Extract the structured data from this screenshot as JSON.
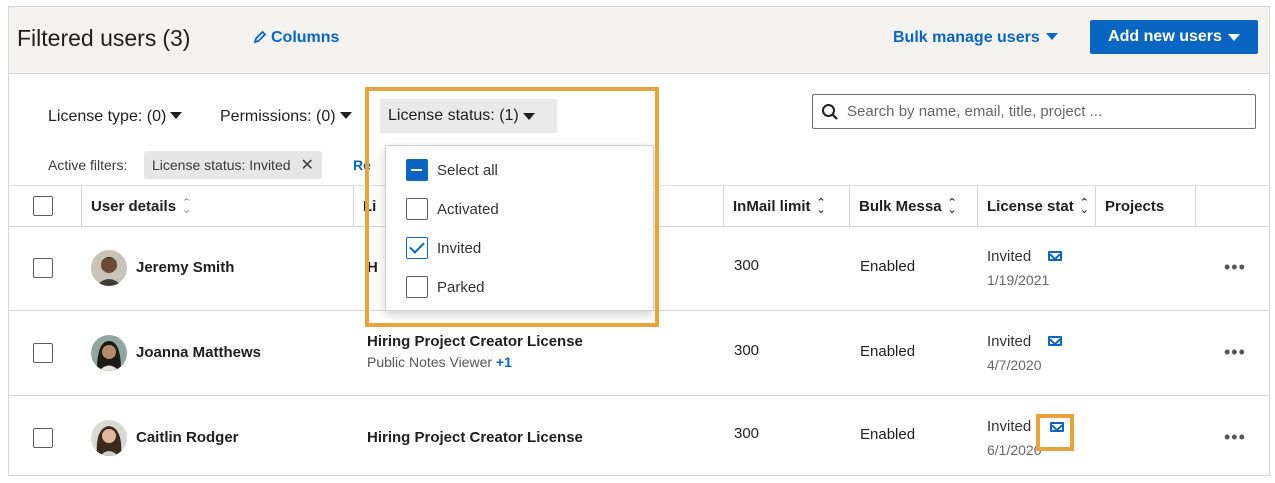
{
  "header": {
    "title": "Filtered users",
    "count": "(3)",
    "columns_label": "Columns",
    "bulk_manage_label": "Bulk manage users",
    "add_users_label": "Add new users"
  },
  "filters": {
    "license_type": "License type:",
    "license_type_count": "(0)",
    "permissions": "Permissions:",
    "permissions_count": "(0)",
    "license_status": "License status:",
    "license_status_count": "(1)",
    "search_placeholder": "Search by name, email, title, project ..."
  },
  "active_filters": {
    "label": "Active filters:",
    "chip": "License status: Invited",
    "chip_close": "✕",
    "reset_partial": "Re"
  },
  "menu": {
    "items": [
      {
        "label": "Select all",
        "state": "indeterminate"
      },
      {
        "label": "Activated",
        "state": "unchecked"
      },
      {
        "label": "Invited",
        "state": "checked"
      },
      {
        "label": "Parked",
        "state": "unchecked"
      }
    ]
  },
  "table": {
    "columns": {
      "user_details": "User details",
      "license_partial": "Li",
      "inmail": "InMail limit",
      "bulk": "Bulk Messa",
      "license_status": "License stat",
      "projects": "Projects"
    },
    "rows": [
      {
        "name": "Jeremy Smith",
        "license": "H",
        "license_sub": "",
        "license_plus": "",
        "inmail": "300",
        "bulk": "Enabled",
        "status": "Invited",
        "date": "1/19/2021",
        "more": "•••"
      },
      {
        "name": "Joanna Matthews",
        "license": "Hiring Project Creator License",
        "license_sub": "Public Notes Viewer",
        "license_plus": "+1",
        "inmail": "300",
        "bulk": "Enabled",
        "status": "Invited",
        "date": "4/7/2020",
        "more": "•••"
      },
      {
        "name": "Caitlin Rodger",
        "license": "Hiring Project Creator License",
        "license_sub": "",
        "license_plus": "",
        "inmail": "300",
        "bulk": "Enabled",
        "status": "Invited",
        "date": "6/1/2020",
        "more": "•••"
      }
    ]
  },
  "colors": {
    "accent": "#0a66c2",
    "highlight": "#e8a33d",
    "header_bg": "#f3f2ef"
  }
}
